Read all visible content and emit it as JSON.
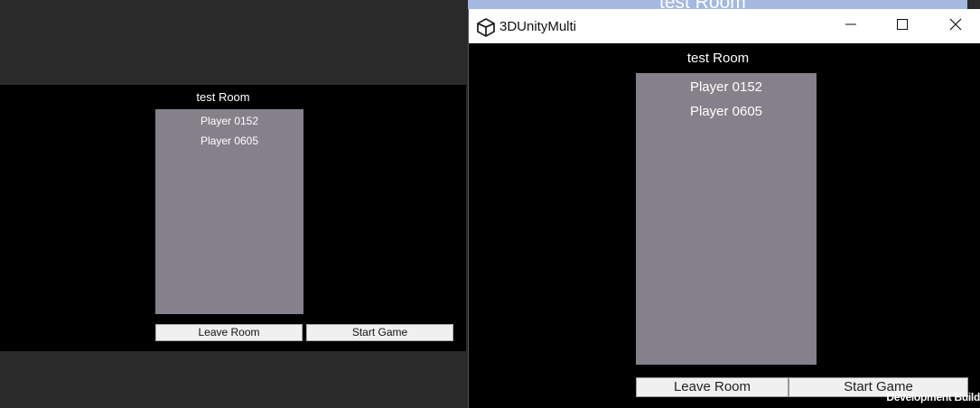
{
  "editor_view": {
    "room_title": "test Room",
    "players": [
      "Player 0152",
      "Player 0605"
    ],
    "leave_button": "Leave Room",
    "start_button": "Start Game"
  },
  "background_window": {
    "partial_title": "test Room"
  },
  "standalone_window": {
    "app_title": "3DUnityMulti",
    "icon": "unity-logo-icon",
    "controls": [
      "minimize-icon",
      "maximize-icon",
      "close-icon"
    ],
    "room_title": "test Room",
    "players": [
      "Player 0152",
      "Player 0605"
    ],
    "leave_button": "Leave Room",
    "start_button": "Start Game",
    "watermark": "Development Build"
  },
  "colors": {
    "list_panel": "#85818a",
    "game_bg": "#000000",
    "desktop_bg": "#2a2a2a",
    "button_bg": "#f0f0f0"
  }
}
